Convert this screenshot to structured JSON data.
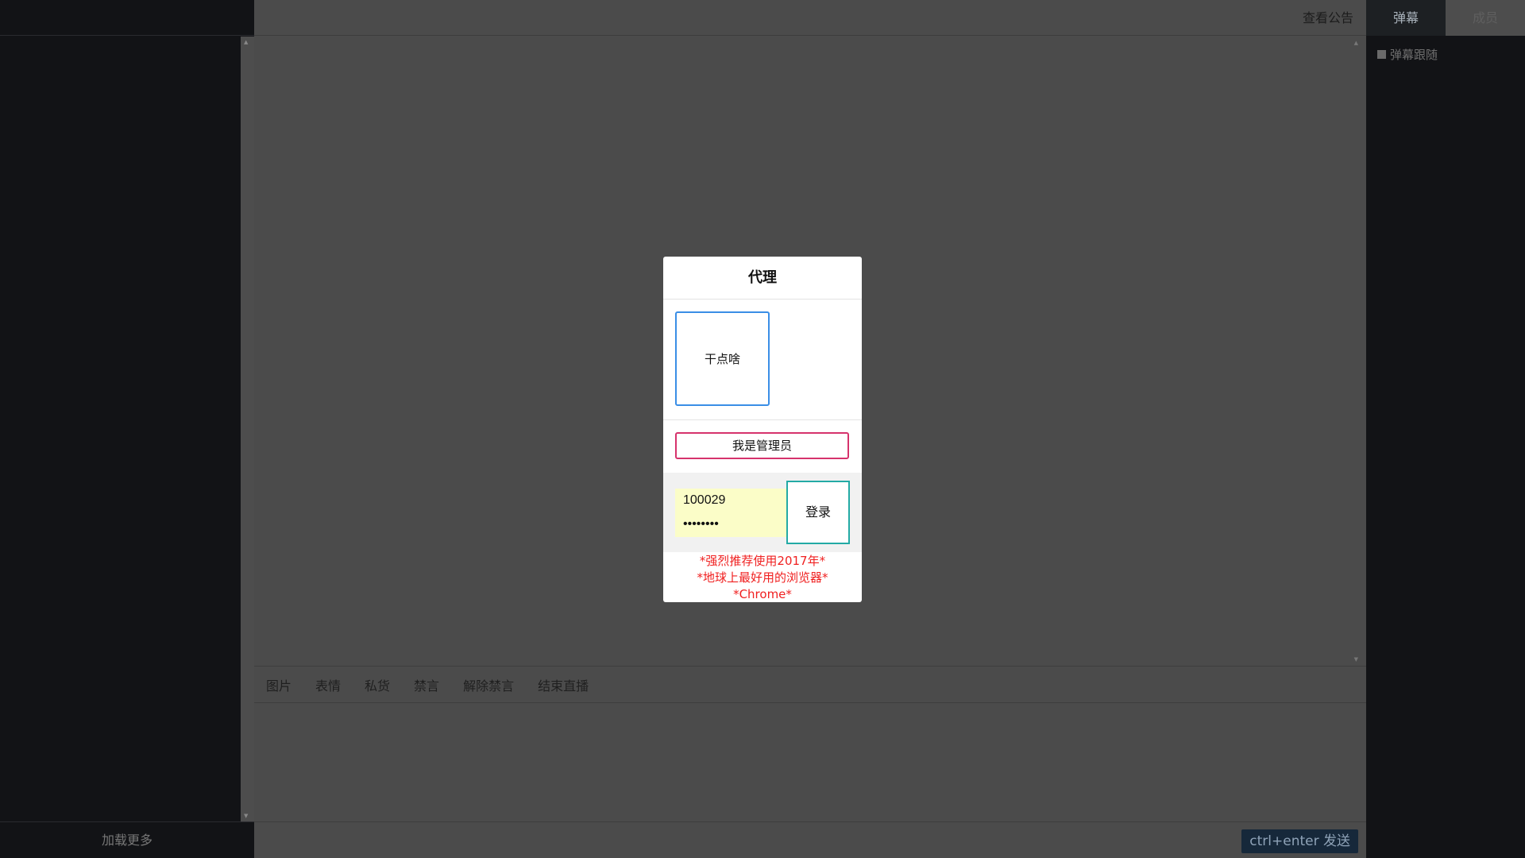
{
  "sidebar": {
    "load_more": "加载更多"
  },
  "header": {
    "notice_link": "查看公告"
  },
  "toolbar": {
    "tools": [
      "图片",
      "表情",
      "私货",
      "禁言",
      "解除禁言",
      "结束直播"
    ]
  },
  "composer": {
    "send_label": "ctrl+enter 发送"
  },
  "right_panel": {
    "tabs": [
      "弹幕",
      "成员"
    ],
    "active_tab": "弹幕",
    "follow_label": "弹幕跟随"
  },
  "modal": {
    "title": "代理",
    "option_card": "干点啥",
    "admin_button": "我是管理员",
    "username_value": "100029",
    "password_value": "12345678",
    "login_button": "登录",
    "notes": [
      "*强烈推荐使用2017年*",
      "*地球上最好用的浏览器*",
      "*Chrome*"
    ]
  },
  "colors": {
    "page_bg": "#4b4b4b",
    "side_bg": "#121316",
    "option_border": "#3a8ee6",
    "admin_border": "#d6336c",
    "login_border": "#23aaa5",
    "input_bg": "#fbfdc8",
    "note_text": "#f02020",
    "send_bg": "#16283a"
  }
}
